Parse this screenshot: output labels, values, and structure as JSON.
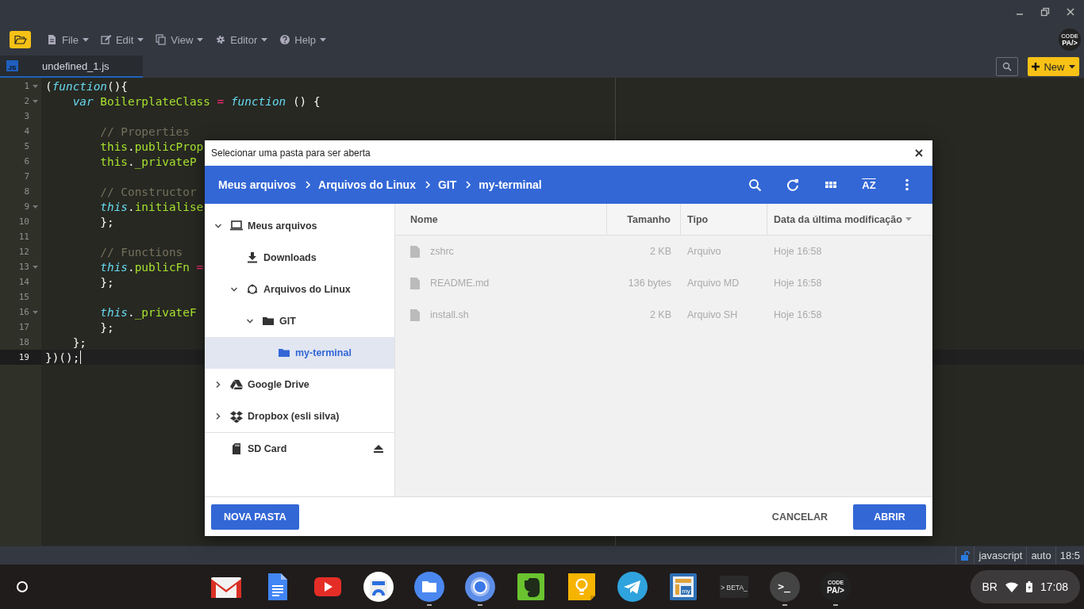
{
  "window_controls": [
    {
      "kind": "minimize"
    },
    {
      "kind": "maximize"
    },
    {
      "kind": "close"
    }
  ],
  "menu": [
    {
      "label": "File"
    },
    {
      "label": "Edit"
    },
    {
      "label": "View"
    },
    {
      "label": "Editor"
    },
    {
      "label": "Help"
    }
  ],
  "logo": {
    "line_1": "CODE",
    "line_2": "PA/>"
  },
  "tabs": [
    {
      "badge": "JS",
      "label": "undefined_1.js",
      "selected": true
    }
  ],
  "new_button": {
    "label": "New"
  },
  "code_lines": [
    {
      "number": "1",
      "foldable": true,
      "active": false,
      "tokens": [
        {
          "kind": "punc",
          "text": "("
        },
        {
          "kind": "kw",
          "text": "function"
        },
        {
          "kind": "punc",
          "text": "(){"
        }
      ]
    },
    {
      "number": "2",
      "foldable": true,
      "active": false,
      "tokens": [
        {
          "kind": "kw",
          "text": "    var"
        },
        {
          "kind": "id",
          "text": " BoilerplateClass"
        },
        {
          "kind": "op",
          "text": " ="
        },
        {
          "kind": "kw",
          "text": " function"
        },
        {
          "kind": "punc",
          "text": " () {"
        }
      ]
    },
    {
      "number": "3",
      "foldable": false,
      "active": false
    },
    {
      "number": "4",
      "foldable": false,
      "active": false,
      "tokens": [
        {
          "kind": "cm",
          "text": "        // Properties"
        }
      ]
    },
    {
      "number": "5",
      "foldable": false,
      "active": false,
      "tokens": [
        {
          "kind": "id",
          "text": "        this"
        },
        {
          "kind": "punc",
          "text": "."
        },
        {
          "kind": "id",
          "text": "publicProp"
        }
      ]
    },
    {
      "number": "6",
      "foldable": false,
      "active": false,
      "tokens": [
        {
          "kind": "id",
          "text": "        this"
        },
        {
          "kind": "punc",
          "text": "."
        },
        {
          "kind": "id",
          "text": "_privateP"
        }
      ]
    },
    {
      "number": "7",
      "foldable": false,
      "active": false
    },
    {
      "number": "8",
      "foldable": false,
      "active": false,
      "tokens": [
        {
          "kind": "cm",
          "text": "        // Constructor"
        }
      ]
    },
    {
      "number": "9",
      "foldable": true,
      "active": false,
      "tokens": [
        {
          "kind": "kw",
          "text": "        this"
        },
        {
          "kind": "punc",
          "text": "."
        },
        {
          "kind": "id",
          "text": "initialise"
        }
      ]
    },
    {
      "number": "10",
      "foldable": false,
      "active": false,
      "tokens": [
        {
          "kind": "punc",
          "text": "        };"
        }
      ]
    },
    {
      "number": "11",
      "foldable": false,
      "active": false
    },
    {
      "number": "12",
      "foldable": false,
      "active": false,
      "tokens": [
        {
          "kind": "cm",
          "text": "        // Functions"
        }
      ]
    },
    {
      "number": "13",
      "foldable": true,
      "active": false,
      "tokens": [
        {
          "kind": "kw",
          "text": "        this"
        },
        {
          "kind": "punc",
          "text": "."
        },
        {
          "kind": "id",
          "text": "publicFn"
        },
        {
          "kind": "op",
          "text": " ="
        }
      ]
    },
    {
      "number": "14",
      "foldable": false,
      "active": false,
      "tokens": [
        {
          "kind": "punc",
          "text": "        };"
        }
      ]
    },
    {
      "number": "15",
      "foldable": false,
      "active": false
    },
    {
      "number": "16",
      "foldable": true,
      "active": false,
      "tokens": [
        {
          "kind": "kw",
          "text": "        this"
        },
        {
          "kind": "punc",
          "text": "."
        },
        {
          "kind": "id",
          "text": "_privateF"
        }
      ]
    },
    {
      "number": "17",
      "foldable": false,
      "active": false,
      "tokens": [
        {
          "kind": "punc",
          "text": "        };"
        }
      ]
    },
    {
      "number": "18",
      "foldable": false,
      "active": false,
      "tokens": [
        {
          "kind": "punc",
          "text": "    };"
        }
      ]
    },
    {
      "number": "19",
      "foldable": false,
      "active": true,
      "tokens": [
        {
          "kind": "punc",
          "text": "})();"
        }
      ]
    }
  ],
  "status_bar": {
    "locked": false,
    "mode": "javascript",
    "setting": "auto",
    "position": "18:5"
  },
  "dialog": {
    "title": "Selecionar uma pasta para ser aberta",
    "breadcrumbs": [
      "Meus arquivos",
      "Arquivos do Linux",
      "GIT",
      "my-terminal"
    ],
    "sort_label": "AZ",
    "nav": [
      {
        "kind": "computer",
        "label": "Meus arquivos",
        "expanded": true,
        "selected": false,
        "children": [
          {
            "kind": "downloads",
            "label": "Downloads",
            "selected": false
          },
          {
            "kind": "linux",
            "label": "Arquivos do Linux",
            "expanded": true,
            "selected": false,
            "children": [
              {
                "kind": "folder",
                "label": "GIT",
                "expanded": true,
                "selected": false,
                "children": [
                  {
                    "kind": "folder",
                    "label": "my-terminal",
                    "selected": true
                  }
                ]
              }
            ]
          }
        ]
      },
      {
        "kind": "drive",
        "label": "Google Drive",
        "expanded": false,
        "selected": false
      },
      {
        "kind": "dropbox",
        "label": "Dropbox (esli silva)",
        "expanded": false,
        "selected": false
      },
      {
        "kind": "sdcard",
        "label": "SD Card",
        "selected": false
      }
    ],
    "columns": [
      {
        "label": "Nome",
        "sorted": false
      },
      {
        "label": "Tamanho",
        "sorted": false
      },
      {
        "label": "Tipo",
        "sorted": false
      },
      {
        "label": "Data da última modificação",
        "sorted": true
      }
    ],
    "files": [
      {
        "name": "zshrc",
        "size": "2 KB",
        "type": "Arquivo",
        "modified": "Hoje 16:58",
        "disabled": true
      },
      {
        "name": "README.md",
        "size": "136 bytes",
        "type": "Arquivo MD",
        "modified": "Hoje 16:58",
        "disabled": true
      },
      {
        "name": "install.sh",
        "size": "2 KB",
        "type": "Arquivo SH",
        "modified": "Hoje 16:58",
        "disabled": true
      }
    ],
    "new_folder_button": "NOVA PASTA",
    "cancel_button": "CANCELAR",
    "open_button": "ABRIR"
  },
  "shelf": {
    "apps": [
      {
        "kind": "gmail",
        "running": false
      },
      {
        "kind": "docs",
        "running": false
      },
      {
        "kind": "youtube",
        "running": false
      },
      {
        "kind": "webstore",
        "running": false
      },
      {
        "kind": "files",
        "running": true
      },
      {
        "kind": "chrome",
        "running": true
      },
      {
        "kind": "evernote",
        "running": false
      },
      {
        "kind": "keep",
        "running": false
      },
      {
        "kind": "telegram",
        "running": false
      },
      {
        "kind": "my",
        "running": false,
        "label": "my"
      },
      {
        "kind": "beta",
        "running": false,
        "label": "> BETA_"
      },
      {
        "kind": "terminal",
        "running": true,
        "label": ">_"
      },
      {
        "kind": "codepad",
        "running": true,
        "label": "CODE",
        "label_2": "PA/>"
      }
    ],
    "tray": {
      "keyboard": "BR",
      "time": "17:08"
    }
  }
}
